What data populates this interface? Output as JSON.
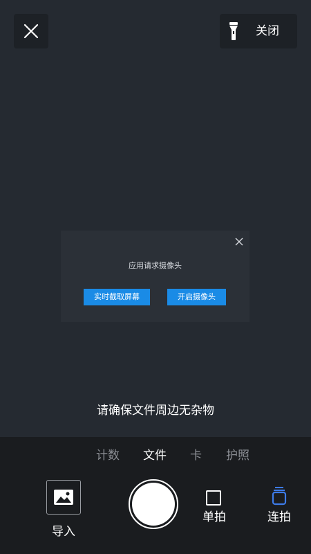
{
  "top_bar": {
    "torch_label": "关闭"
  },
  "dialog": {
    "title": "应用请求摄像头",
    "screen_capture_label": "实时截取屏幕",
    "open_camera_label": "开启摄像头"
  },
  "hint": "请确保文件周边无杂物",
  "modes": {
    "tabs": [
      {
        "label": "计数"
      },
      {
        "label": "文件"
      },
      {
        "label": "卡"
      },
      {
        "label": "护照"
      }
    ],
    "active_tab": "文件"
  },
  "controls": {
    "import_label": "导入",
    "single_label": "单拍",
    "burst_label": "连拍",
    "selected_shot_mode": "连拍"
  },
  "colors": {
    "accent": "#1a8be6",
    "burst_active": "#3d7be8",
    "background": "#252a31",
    "panel": "#1a1c1f"
  },
  "icons": {
    "close": "close-icon",
    "torch": "flashlight-icon",
    "dialog_close": "close-icon",
    "import": "image-icon",
    "single": "square-icon",
    "burst": "stack-icon"
  }
}
